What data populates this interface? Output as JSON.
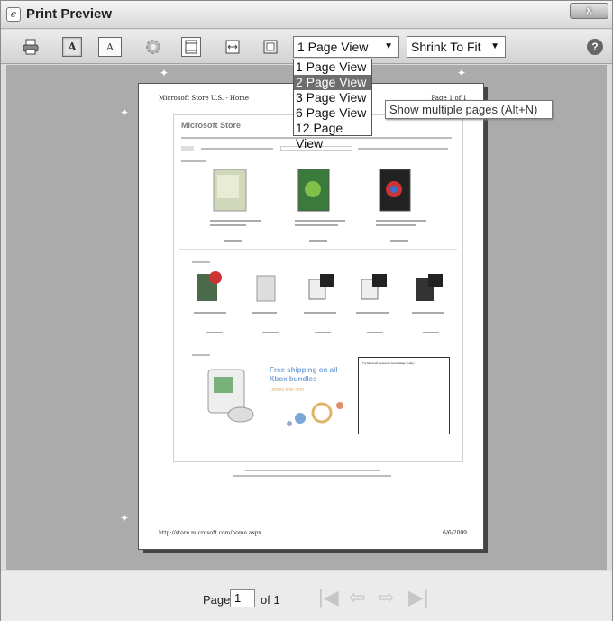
{
  "window": {
    "title": "Print Preview",
    "close_symbol": "x"
  },
  "toolbar": {
    "buttons": [
      {
        "name": "print-button",
        "icon": "printer-icon"
      },
      {
        "name": "portrait-button",
        "icon": "portrait-orientation-icon",
        "glyph": "A"
      },
      {
        "name": "landscape-button",
        "icon": "landscape-orientation-icon",
        "glyph": "A"
      },
      {
        "name": "page-setup-button",
        "icon": "gear-icon"
      },
      {
        "name": "headers-footers-button",
        "icon": "header-footer-icon"
      },
      {
        "name": "full-width-button",
        "icon": "full-width-icon"
      },
      {
        "name": "full-page-button",
        "icon": "full-page-icon"
      }
    ],
    "page_view": "1 Page View",
    "shrink": "Shrink To Fit",
    "help": "?"
  },
  "page_view_menu": {
    "options": [
      "1 Page View",
      "2 Page View",
      "3 Page View",
      "6 Page View",
      "12 Page View"
    ],
    "highlighted_index": 1
  },
  "tooltip": "Show multiple pages (Alt+N)",
  "printed_page": {
    "header_left": "Microsoft Store U.S. - Home",
    "header_right": "Page 1 of 1",
    "footer_left": "http://store.microsoft.com/home.aspx",
    "footer_right": "6/6/2009",
    "site_logo": "Microsoft Store",
    "ad_title": "Free shipping on all Xbox bundles",
    "ad_subtitle": "Limited time offer",
    "side_box_text": "Try Microsoft Research AutoCollage Today!"
  },
  "statusbar": {
    "page_label": "Page",
    "page_value": "1",
    "of_label": "of 1"
  },
  "colors": {
    "preview_background": "#ababab",
    "menu_highlight": "#6e6e6e",
    "ad_title": "#7aa7d8"
  }
}
